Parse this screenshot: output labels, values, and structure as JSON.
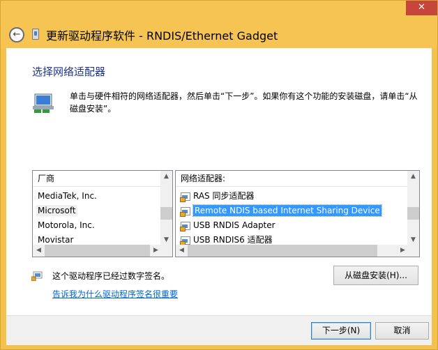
{
  "titlebar": {
    "close_symbol": "✕",
    "back_symbol": "←",
    "title": "更新驱动程序软件 - RNDIS/Ethernet Gadget"
  },
  "main": {
    "heading": "选择网络适配器",
    "description": "单击与硬件相符的网络适配器，然后单击“下一步”。如果你有这个功能的安装磁盘，请单击“从磁盘安装”。"
  },
  "manufacturers": {
    "header": "厂商",
    "items": [
      "MediaTek, Inc.",
      "Microsoft",
      "Motorola, Inc.",
      "Movistar"
    ],
    "selected": "Microsoft"
  },
  "adapters": {
    "header": "网络适配器:",
    "items": [
      "RAS 同步适配器",
      "Remote NDIS based Internet Sharing Device",
      "USB RNDIS Adapter",
      "USB RNDIS6 适配器"
    ],
    "selected": "Remote NDIS based Internet Sharing Device"
  },
  "signature": {
    "text": "这个驱动程序已经过数字签名。",
    "link": "告诉我为什么驱动程序签名很重要"
  },
  "buttons": {
    "have_disk": "从磁盘安装(H)...",
    "next": "下一步(N)",
    "cancel": "取消"
  },
  "scroll_arrows": {
    "up": "▲",
    "down": "▼",
    "left": "◀",
    "right": "▶"
  },
  "colors": {
    "accent": "#f2c24c",
    "heading": "#1e3287",
    "link": "#0066cc",
    "selection": "#3399ff"
  }
}
